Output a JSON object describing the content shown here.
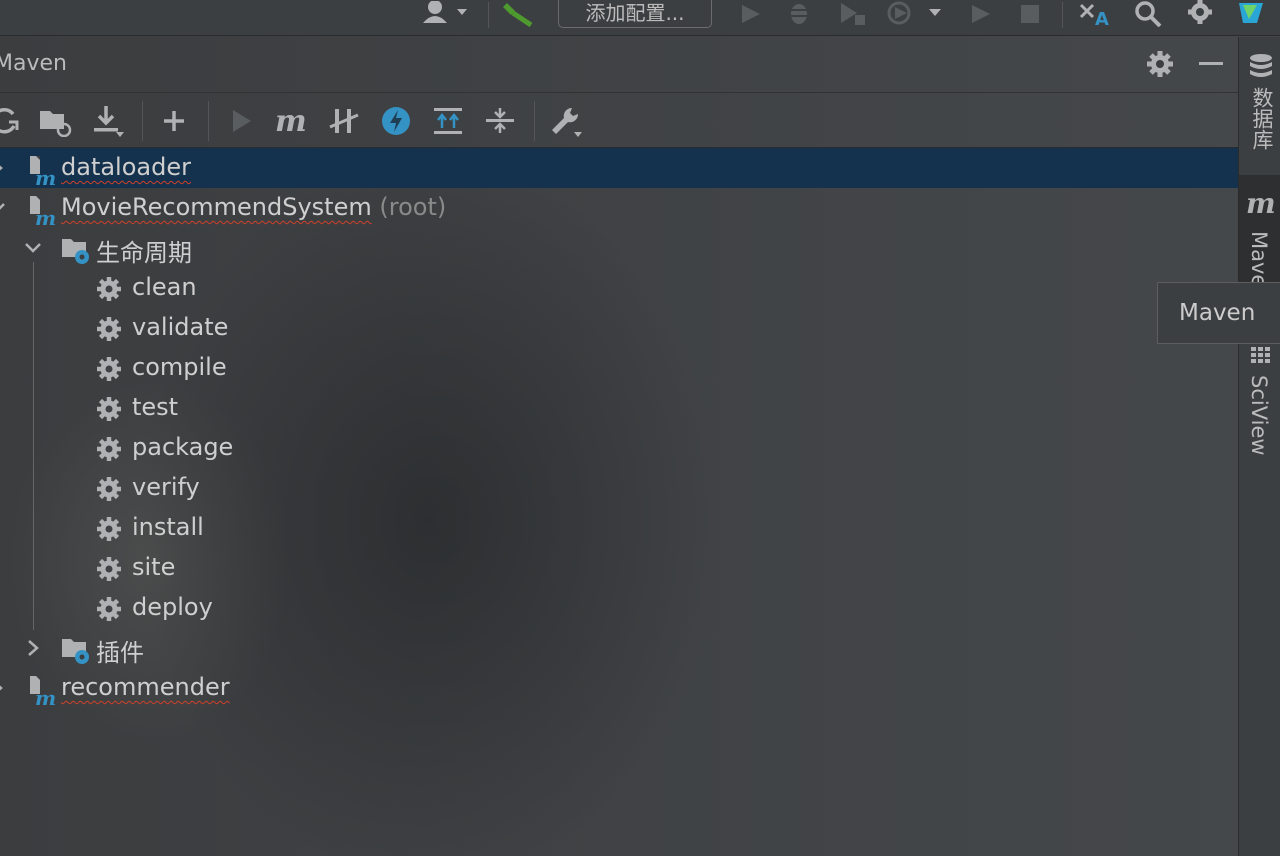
{
  "toolbar": {
    "config_button": "添加配置...",
    "icons": [
      "user-icon",
      "build-hammer-icon",
      "run-icon",
      "debug-icon",
      "coverage-icon",
      "profile-icon",
      "run-disabled-icon",
      "stop-icon",
      "translate-icon",
      "search-icon",
      "settings-icon",
      "plugin-logo-icon"
    ]
  },
  "panel": {
    "title": "Maven",
    "header_icons": [
      "gear-icon",
      "minimize-icon"
    ],
    "toolbar_icons": [
      "reload-icon",
      "open-folder-icon",
      "download-icon",
      "add-icon",
      "run-icon",
      "maven-goal-icon",
      "skip-tests-icon",
      "offline-icon",
      "expand-all-icon",
      "collapse-all-icon",
      "settings-wrench-icon"
    ]
  },
  "tree": {
    "projects": [
      {
        "name": "dataloader",
        "selected": true
      },
      {
        "name": "MovieRecommendSystem",
        "suffix": "(root)"
      },
      {
        "name": "recommender"
      }
    ],
    "lifecycle_label": "生命周期",
    "plugins_label": "插件",
    "goals": [
      "clean",
      "validate",
      "compile",
      "test",
      "package",
      "verify",
      "install",
      "site",
      "deploy"
    ]
  },
  "stripe": {
    "tabs": [
      {
        "label": "数据库",
        "icon": "database-icon"
      },
      {
        "label": "Maven",
        "icon": "maven-m-icon",
        "active": true
      },
      {
        "label": "SciView",
        "icon": "grid-icon"
      }
    ]
  },
  "tooltip": {
    "text": "Maven"
  },
  "colors": {
    "selection": "#14324d",
    "accent_blue": "#3592c4",
    "green": "#4e9a2f",
    "error_squiggle": "#d0402a"
  }
}
